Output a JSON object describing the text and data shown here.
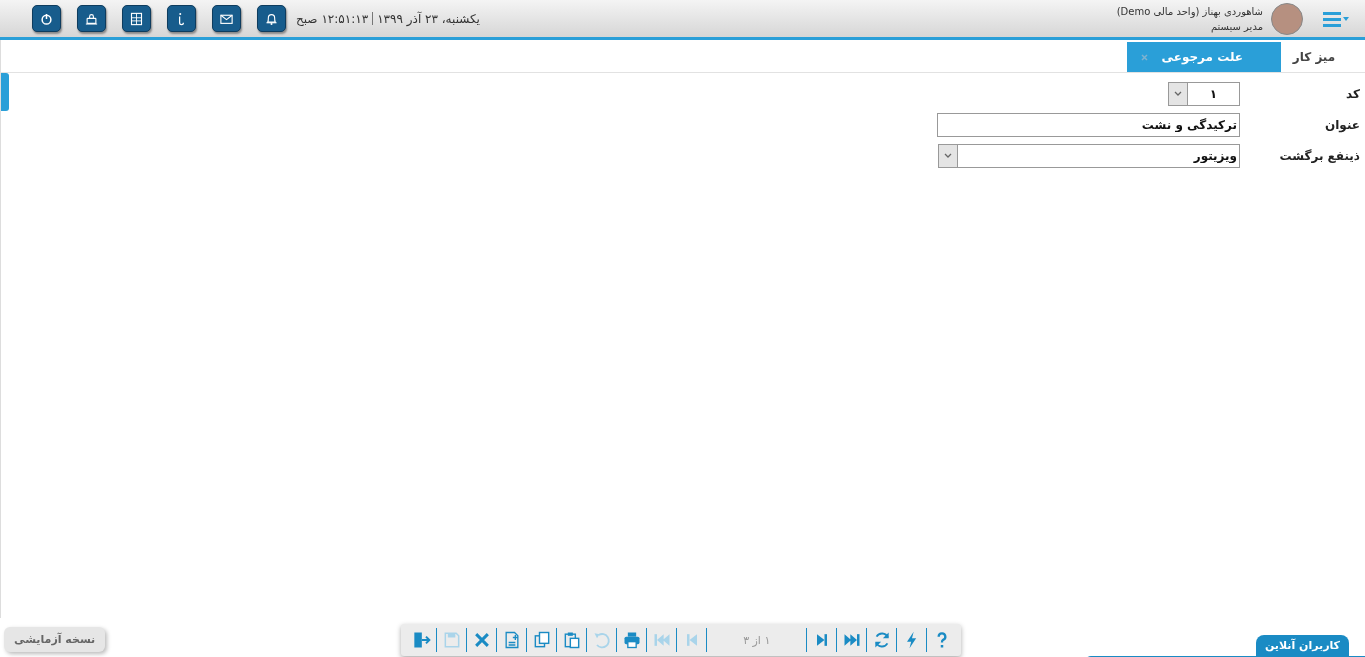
{
  "header": {
    "user_name": "شاهوردی بهناز (واحد مالی Demo)",
    "user_role": "مدیر سیستم",
    "date": "یکشنبه، ۲۳ آذر ۱۳۹۹",
    "time": "۱۲:۵۱:۱۳ صبح",
    "tools": [
      {
        "kind": "power"
      },
      {
        "kind": "lock"
      },
      {
        "kind": "calculator"
      },
      {
        "kind": "info"
      },
      {
        "kind": "mail"
      },
      {
        "kind": "bell"
      }
    ]
  },
  "tabs": [
    {
      "label": "میز کار",
      "selected": false
    },
    {
      "label": "علت مرجوعی",
      "selected": true
    }
  ],
  "form": [
    {
      "label": "کد",
      "value": "۱",
      "kind": "combo"
    },
    {
      "label": "عنوان",
      "value": "ترکیدگی و نشت",
      "kind": "text"
    },
    {
      "label": "ذینفع برگشت",
      "value": "ویزیتور",
      "kind": "select"
    }
  ],
  "toolbar": {
    "buttons": [
      {
        "kind": "exit",
        "disabled": false
      },
      {
        "kind": "save",
        "disabled": true
      },
      {
        "kind": "delete",
        "disabled": false
      },
      {
        "kind": "new",
        "disabled": false
      },
      {
        "kind": "copy",
        "disabled": false
      },
      {
        "kind": "paste",
        "disabled": false
      },
      {
        "kind": "undo",
        "disabled": true
      },
      {
        "kind": "print",
        "disabled": false
      },
      {
        "kind": "first",
        "disabled": true
      },
      {
        "kind": "prev",
        "disabled": true
      },
      {
        "kind": "pager",
        "text": "۱ از ۳"
      },
      {
        "kind": "next",
        "disabled": false
      },
      {
        "kind": "last",
        "disabled": false
      },
      {
        "kind": "refresh",
        "disabled": false
      },
      {
        "kind": "flash",
        "disabled": false
      },
      {
        "kind": "help",
        "disabled": false
      }
    ]
  },
  "trial_badge": "نسخه آزمایشی",
  "online_users": "کاربران آنلاین"
}
